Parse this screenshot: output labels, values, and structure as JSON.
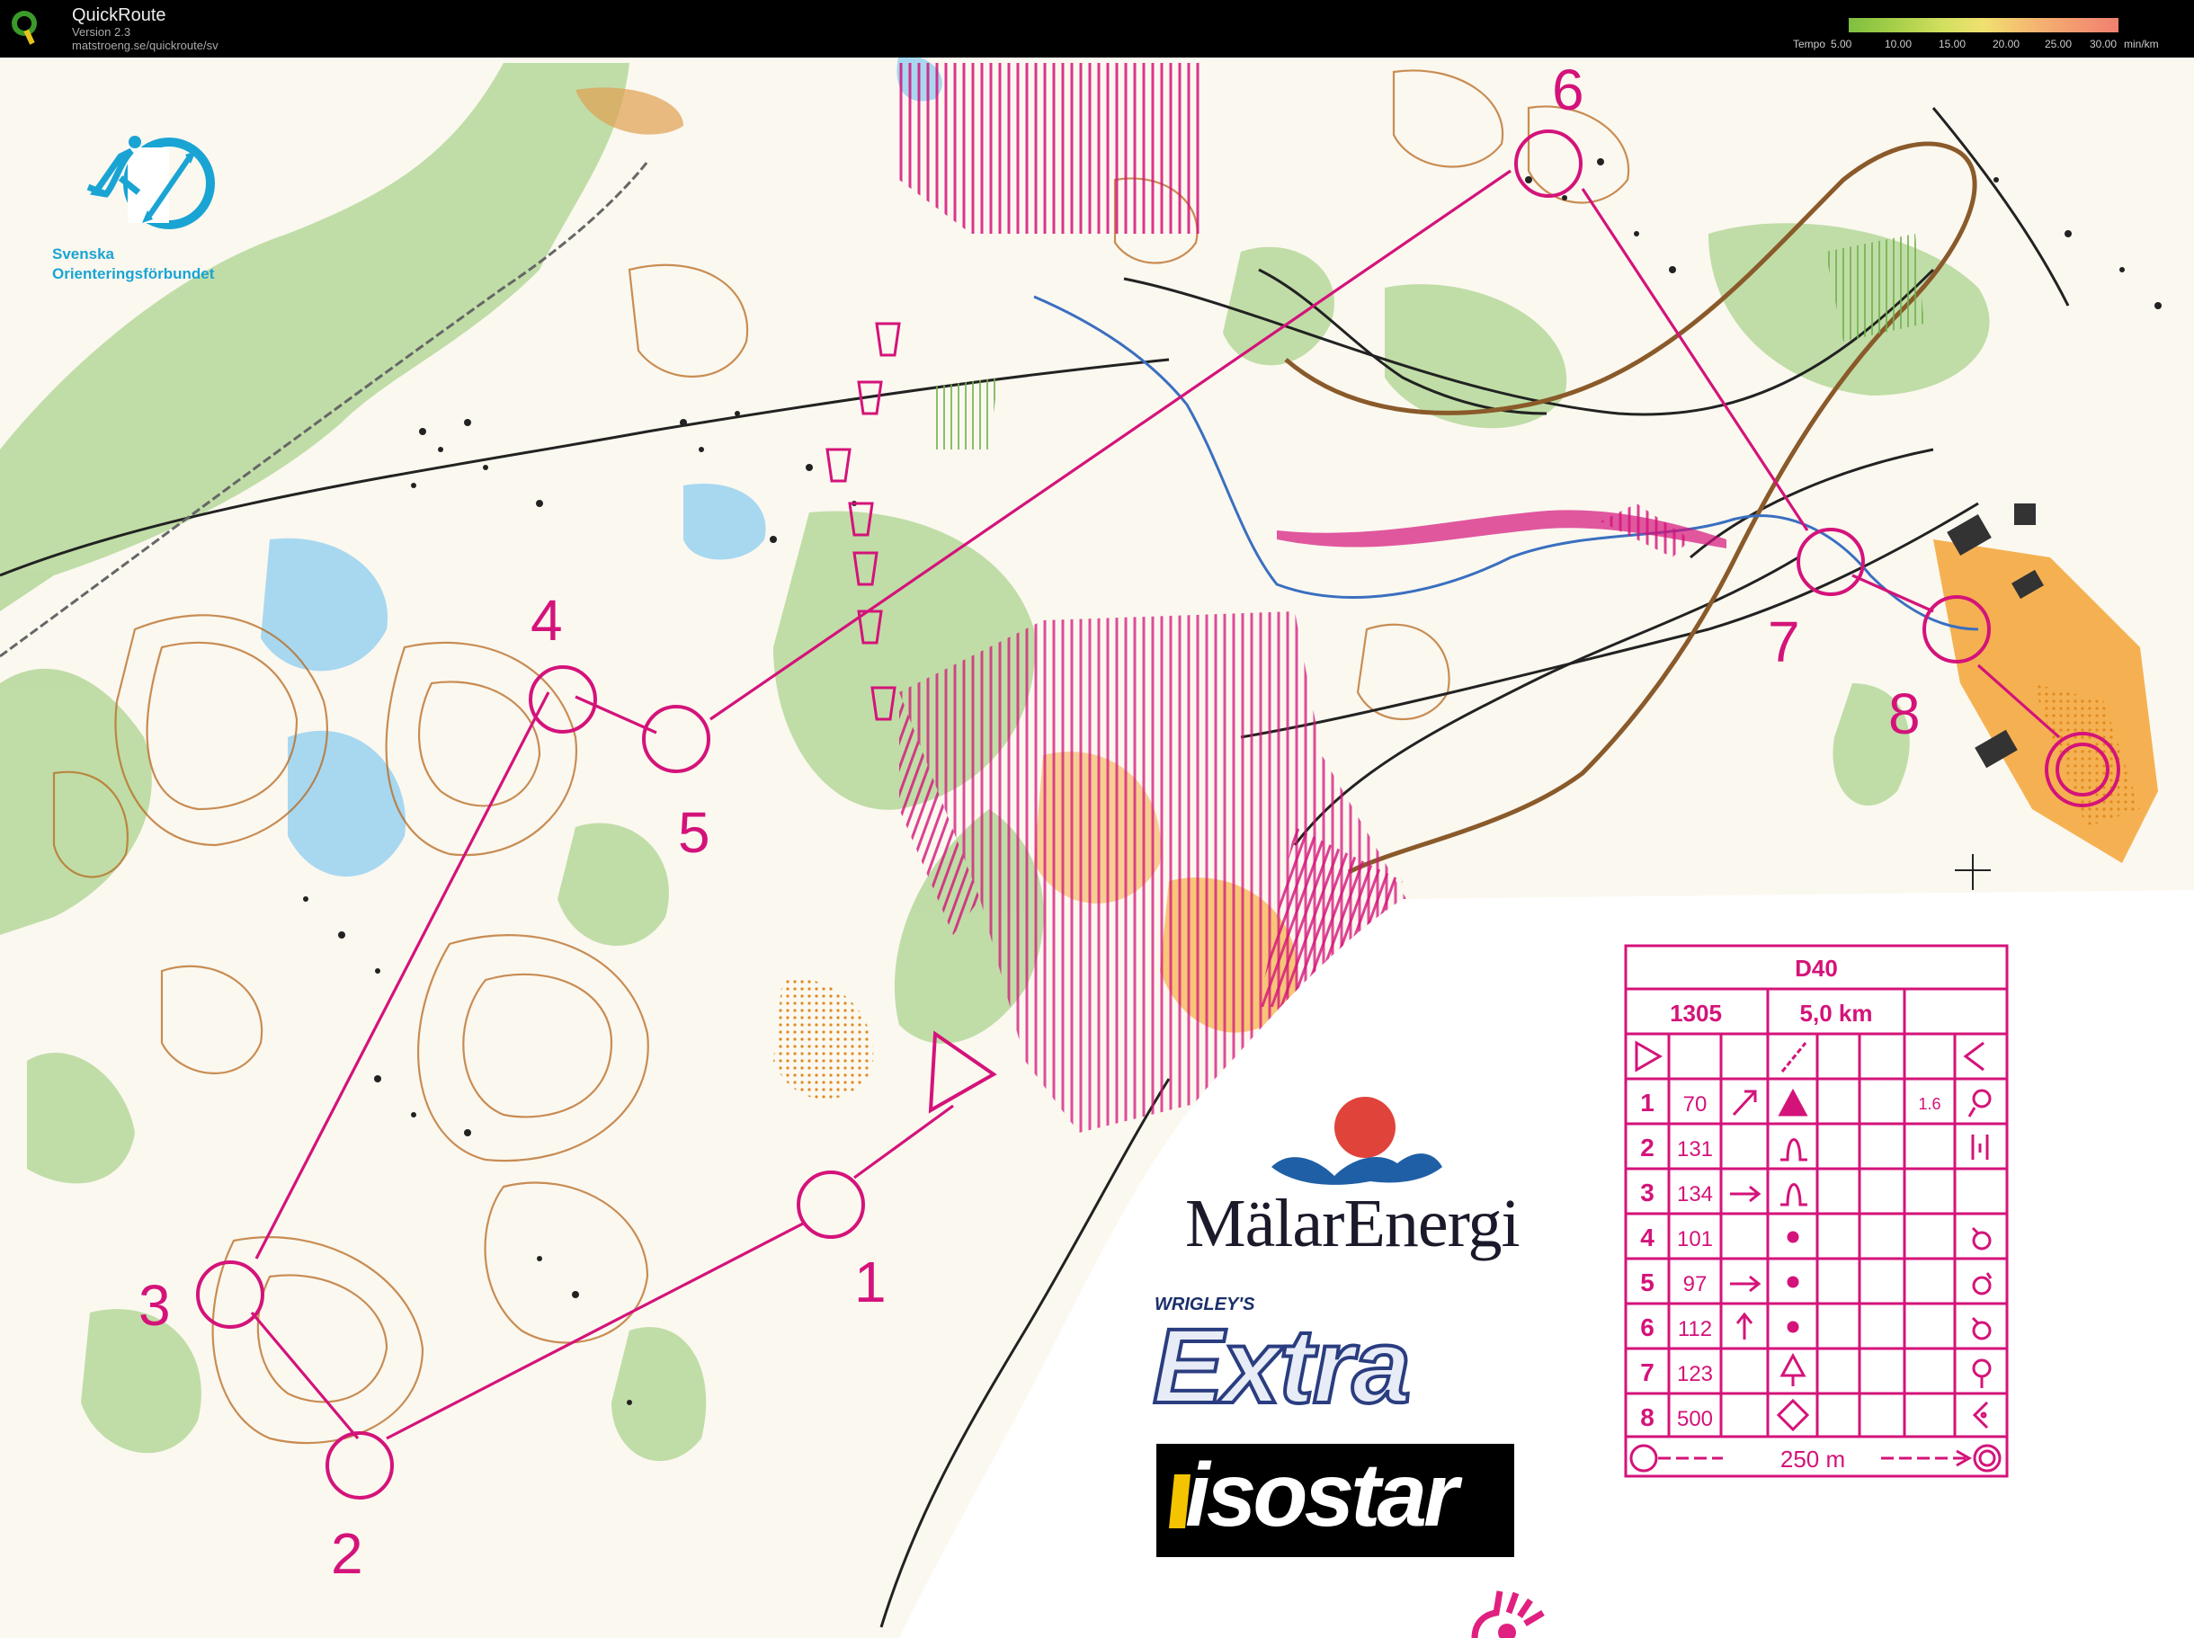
{
  "app": {
    "title": "QuickRoute",
    "version": "Version 2.3",
    "url": "matstroeng.se/quickroute/sv"
  },
  "tempo_legend": {
    "label": "Tempo",
    "ticks": [
      "5.00",
      "10.00",
      "15.00",
      "20.00",
      "25.00",
      "30.00"
    ],
    "unit": "min/km"
  },
  "map": {
    "colors": {
      "course": "#d4137a",
      "forest_green": "#a8d08a",
      "contour": "#b8691f",
      "water": "#55b8e8",
      "open_land": "#f6b95a",
      "road": "#222222"
    },
    "control_labels": [
      "1",
      "2",
      "3",
      "4",
      "5",
      "6",
      "7",
      "8"
    ]
  },
  "course_table": {
    "class": "D40",
    "code": "1305",
    "length": "5,0 km",
    "rows": [
      {
        "num": "1",
        "code": "70",
        "dist_icon": "arrow-ne",
        "feature": "triangle",
        "extra": "1.6",
        "detail": "detail-a"
      },
      {
        "num": "2",
        "code": "131",
        "dist_icon": "",
        "feature": "knoll",
        "extra": "",
        "detail": "detail-b"
      },
      {
        "num": "3",
        "code": "134",
        "dist_icon": "arrow-right",
        "feature": "knoll",
        "extra": "",
        "detail": ""
      },
      {
        "num": "4",
        "code": "101",
        "dist_icon": "",
        "feature": "dot",
        "extra": "",
        "detail": "detail-c"
      },
      {
        "num": "5",
        "code": "97",
        "dist_icon": "arrow-right",
        "feature": "dot",
        "extra": "",
        "detail": "detail-c"
      },
      {
        "num": "6",
        "code": "112",
        "dist_icon": "arrow-up",
        "feature": "dot",
        "extra": "",
        "detail": "detail-c"
      },
      {
        "num": "7",
        "code": "123",
        "dist_icon": "",
        "feature": "tree",
        "extra": "",
        "detail": "detail-d"
      },
      {
        "num": "8",
        "code": "500",
        "dist_icon": "",
        "feature": "diamond",
        "extra": "",
        "detail": "detail-e"
      }
    ],
    "finish_distance": "250 m"
  },
  "logos": {
    "sof_line1": "Svenska",
    "sof_line2": "Orienteringsförbundet",
    "malar": "MälarEnergi",
    "wrigley": "WRIGLEY'S",
    "extra": "Extra",
    "isostar": "isostar"
  }
}
